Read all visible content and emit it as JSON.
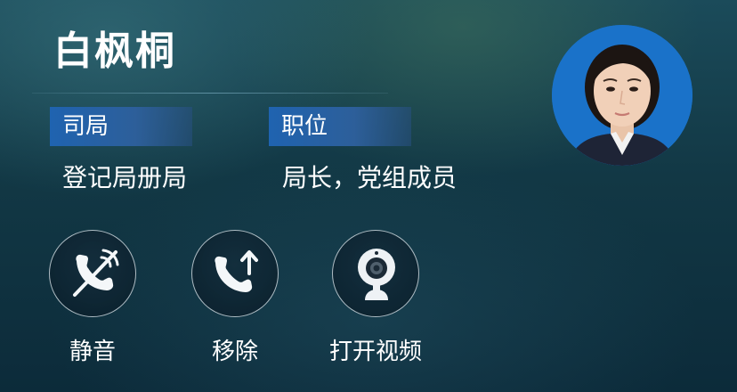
{
  "contact": {
    "name": "白枫桐",
    "department_label": "司局",
    "department_value": "登记局册局",
    "position_label": "职位",
    "position_value": "局长，党组成员"
  },
  "actions": [
    {
      "label": "静音",
      "icon": "mute-call-icon"
    },
    {
      "label": "移除",
      "icon": "remove-call-icon"
    },
    {
      "label": "打开视频",
      "icon": "webcam-icon"
    }
  ],
  "colors": {
    "label_background": "#1f63b0",
    "avatar_background": "#1a72c9",
    "text": "#ffffff"
  }
}
